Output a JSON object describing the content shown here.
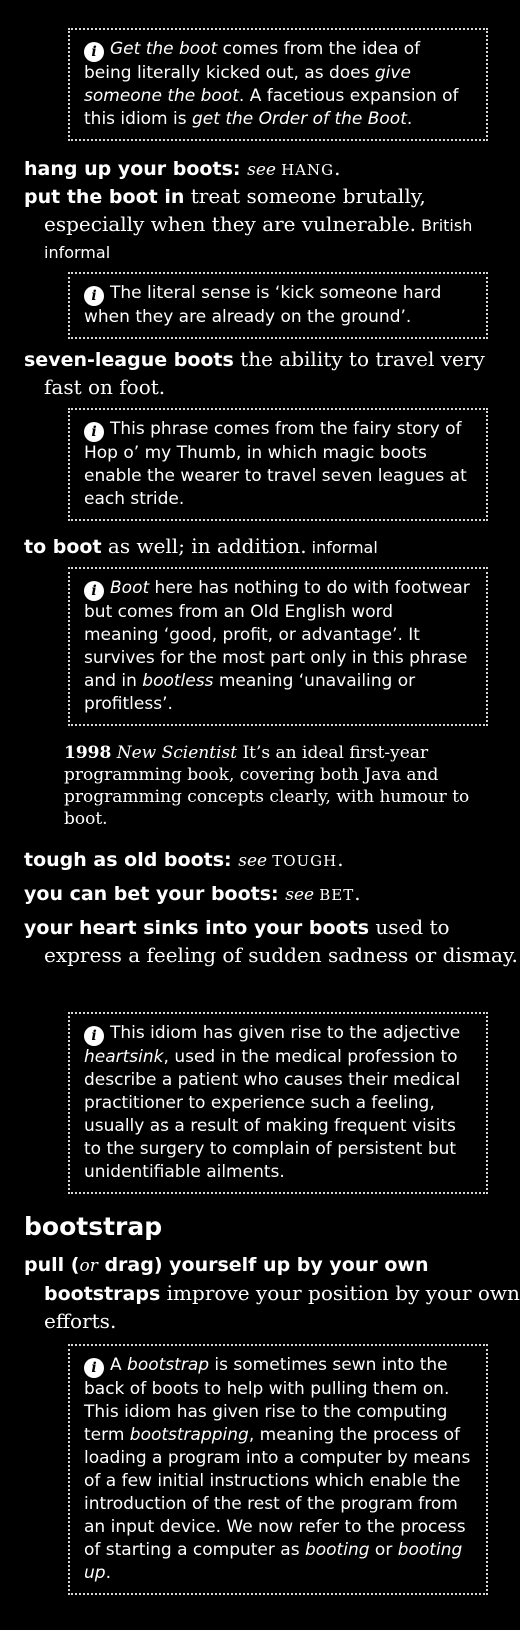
{
  "n1": {
    "t1": "Get the boot",
    "t2": " comes from the idea of being literally kicked out, as does ",
    "t3": "give someone the boot",
    "t4": ". A facetious expansion of this idiom is ",
    "t5": "get the Order of the Boot",
    "t6": "."
  },
  "e1": {
    "hw": "hang up your boots",
    "colon": ": ",
    "see": "see",
    "xref": "HANG",
    "end": "."
  },
  "e2": {
    "hw": "put the boot in",
    "def": " treat someone brutally, especially when they are vulnerable.",
    "label": " British informal"
  },
  "n2": {
    "text": "The literal sense is ‘kick someone hard when they are already on the ground’."
  },
  "e3": {
    "hw": "seven-league boots",
    "def": " the ability to travel very fast on foot."
  },
  "n3": {
    "text": "This phrase comes from the fairy story of Hop o’ my Thumb, in which magic boots enable the wearer to travel seven leagues at each stride."
  },
  "e4": {
    "hw": "to boot",
    "def": " as well; in addition.",
    "label": " informal"
  },
  "n4": {
    "t1": "Boot",
    "t2": " here has nothing to do with footwear but comes from an Old English word meaning ‘good, profit, or advantage’. It survives for the most part only in this phrase and in ",
    "t3": "bootless",
    "t4": " meaning ‘unavailing or profitless’."
  },
  "q1": {
    "year": "1998",
    "source": "New Scientist",
    "text": " It’s an ideal first-year programming book, covering both Java and programming concepts clearly, with humour to boot."
  },
  "e5": {
    "hw": "tough as old boots",
    "colon": ": ",
    "see": "see",
    "xref": "TOUGH",
    "end": "."
  },
  "e6": {
    "hw": "you can bet your boots",
    "colon": ": ",
    "see": "see",
    "xref": "BET",
    "end": "."
  },
  "e7": {
    "hw": "your heart sinks into your boots",
    "def": " used to express a feeling of sudden sadness or dismay."
  },
  "n5": {
    "t1": "This idiom has given rise to the adjective ",
    "t2": "heartsink",
    "t3": ", used in the medical profession to describe a patient who causes their medical practitioner to experience such a feeling, usually as a result of making frequent visits to the surgery to complain of persistent but unidentifiable ailments."
  },
  "head2": "bootstrap",
  "e8": {
    "hw1": "pull (",
    "or": "or",
    "hw2": " drag) yourself up by your own bootstraps",
    "def": " improve your position by your own efforts."
  },
  "n6": {
    "t1": "A ",
    "t2": "bootstrap",
    "t3": " is sometimes sewn into the back of boots to help with pulling them on. This idiom has given rise to the computing term ",
    "t4": "bootstrapping",
    "t5": ", meaning the process of loading a program into a computer by means of a few initial instructions which enable the introduction of the rest of the program from an input device. We now refer to the process of starting a computer as ",
    "t6": "booting",
    "t7": " or ",
    "t8": "booting up",
    "t9": "."
  },
  "icon": "info-icon"
}
